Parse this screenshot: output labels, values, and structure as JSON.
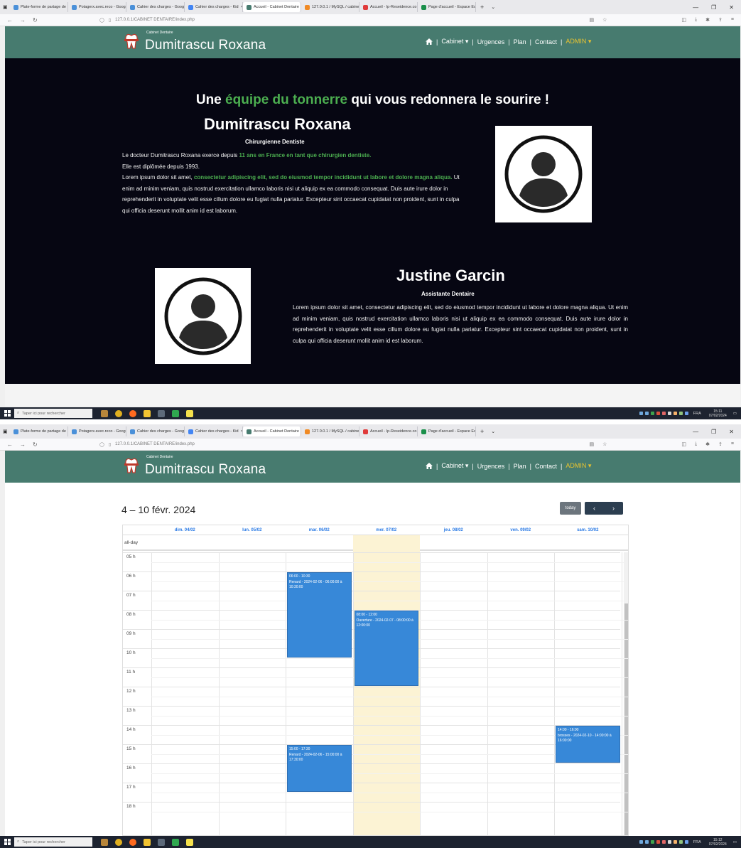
{
  "browser": {
    "tabs": [
      {
        "label": "Plate-forme de partage de",
        "color": "#4a90d9"
      },
      {
        "label": "Potagerx.avec.reco - Goog",
        "color": "#4a90d9"
      },
      {
        "label": "Cahier des charges - Goog",
        "color": "#4a90d9"
      },
      {
        "label": "Cahier des charges - Kid",
        "color": "#4285f4"
      },
      {
        "label": "Accueil - Cabinet Dentaire",
        "color": "#477b6f"
      },
      {
        "label": "127.0.0.1 / MySQL / cabine",
        "color": "#f08a24"
      },
      {
        "label": "Accueil - Ip-Reseidence.co",
        "color": "#e03a3a"
      },
      {
        "label": "Page d'accueil - Espace Ec",
        "color": "#1a8f4a"
      }
    ],
    "url": "127.0.0.1/CABINET DENTAIRE/index.php",
    "window_controls": [
      "—",
      "❐",
      "✕"
    ]
  },
  "navbar": {
    "brand_sub": "Cabinet Dentaire",
    "brand_name": "Dumitrascu Roxana",
    "items": [
      "Cabinet ▾",
      "Urgences",
      "Plan",
      "Contact",
      "ADMIN ▾"
    ],
    "separator": "|"
  },
  "team": {
    "headline_before": "Une ",
    "headline_green": "équipe du tonnerre",
    "headline_after": " qui vous redonnera le sourire !",
    "doctor": {
      "name": "Dumitrascu Roxana",
      "role": "Chirurgienne Dentiste",
      "bio_1": "Le docteur Dumitrascu Roxana exerce depuis ",
      "bio_1_green": "11 ans en France en tant que chirurgien dentiste.",
      "bio_2": "Elle est diplômée depuis 1993.",
      "bio_3": "Lorem ipsum dolor sit amet, ",
      "bio_3_green": "consectetur adipiscing elit, sed do eiusmod tempor incididunt ut labore et dolore magna aliqua.",
      "bio_4": " Ut enim ad minim veniam, quis nostrud exercitation ullamco laboris nisi ut aliquip ex ea commodo consequat. Duis aute irure dolor in reprehenderit in voluptate velit esse cillum dolore eu fugiat nulla pariatur. Excepteur sint occaecat cupidatat non proident, sunt in culpa qui officia deserunt mollit anim id est laborum."
    },
    "assistant": {
      "name": "Justine Garcin",
      "role": "Assistante Dentaire",
      "bio": "Lorem ipsum dolor sit amet, consectetur adipiscing elit, sed do eiusmod tempor incididunt ut labore et dolore magna aliqua. Ut enim ad minim veniam, quis nostrud exercitation ullamco laboris nisi ut aliquip ex ea commodo consequat. Duis aute irure dolor in reprehenderit in voluptate velit esse cillum dolore eu fugiat nulla pariatur. Excepteur sint occaecat cupidatat non proident, sunt in culpa qui officia deserunt mollit anim id est laborum."
    }
  },
  "calendar": {
    "title": "4 – 10 févr. 2024",
    "today_label": "today",
    "prev_label": "‹",
    "next_label": "›",
    "days": [
      "dim. 04/02",
      "lun. 05/02",
      "mar. 06/02",
      "mer. 07/02",
      "jeu. 08/02",
      "ven. 09/02",
      "sam. 10/02"
    ],
    "today_index": 3,
    "allday_label": "all-day",
    "hours": [
      "05 h",
      "06 h",
      "07 h",
      "08 h",
      "09 h",
      "10 h",
      "11 h",
      "12 h",
      "13 h",
      "14 h",
      "15 h",
      "16 h",
      "17 h",
      "18 h"
    ],
    "first_hour": 5,
    "events": [
      {
        "day": 2,
        "start": 6,
        "end": 10.5,
        "time": "06:00 - 10:30",
        "text": "Renard - 2024-02-06 - 06:00:00 à 10:30:00"
      },
      {
        "day": 3,
        "start": 8,
        "end": 12,
        "time": "08:00 - 12:00",
        "text": "Ouverture - 2024-02-07 - 08:00:00 à 12:00:00"
      },
      {
        "day": 2,
        "start": 15,
        "end": 17.5,
        "time": "15:00 - 17:30",
        "text": "Renard - 2024-02-06 - 15:00:00 à 17:30:00"
      },
      {
        "day": 6,
        "start": 14,
        "end": 16,
        "time": "14:00 - 16:00",
        "text": "brosses - 2024-02-10 - 14:00:00 à 16:00:00"
      }
    ]
  },
  "taskbar": {
    "search_placeholder": "Taper ici pour rechercher",
    "lang": "FRA",
    "clock_1": "15:11",
    "clock_2": "15:12",
    "date": "07/02/2024"
  }
}
